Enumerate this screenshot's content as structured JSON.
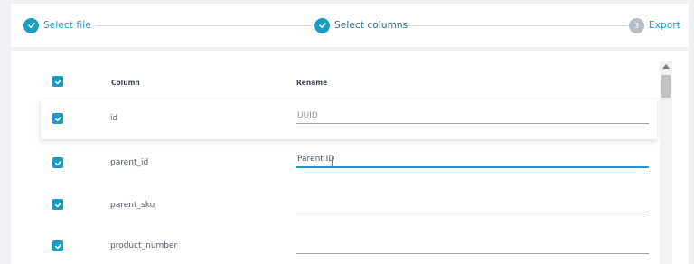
{
  "colors": {
    "accent": "#1a9cc4",
    "pending": "#b9bec4",
    "text": "#4a5563"
  },
  "stepper": {
    "steps": [
      {
        "label": "Select file",
        "state": "done",
        "icon": "check-icon"
      },
      {
        "label": "Select columns",
        "state": "active",
        "icon": "check-icon"
      },
      {
        "label": "Export",
        "state": "pending",
        "number": "3"
      }
    ]
  },
  "table": {
    "headers": {
      "column": "Column",
      "rename": "Rename"
    },
    "rows": [
      {
        "column": "id",
        "rename_value": "",
        "rename_placeholder": "UUID",
        "checked": true
      },
      {
        "column": "parent_id",
        "rename_value": "Parent ID",
        "rename_placeholder": "",
        "checked": true,
        "focused": true
      },
      {
        "column": "parent_sku",
        "rename_value": "",
        "rename_placeholder": "",
        "checked": true
      },
      {
        "column": "product_number",
        "rename_value": "",
        "rename_placeholder": "",
        "checked": true
      }
    ]
  }
}
